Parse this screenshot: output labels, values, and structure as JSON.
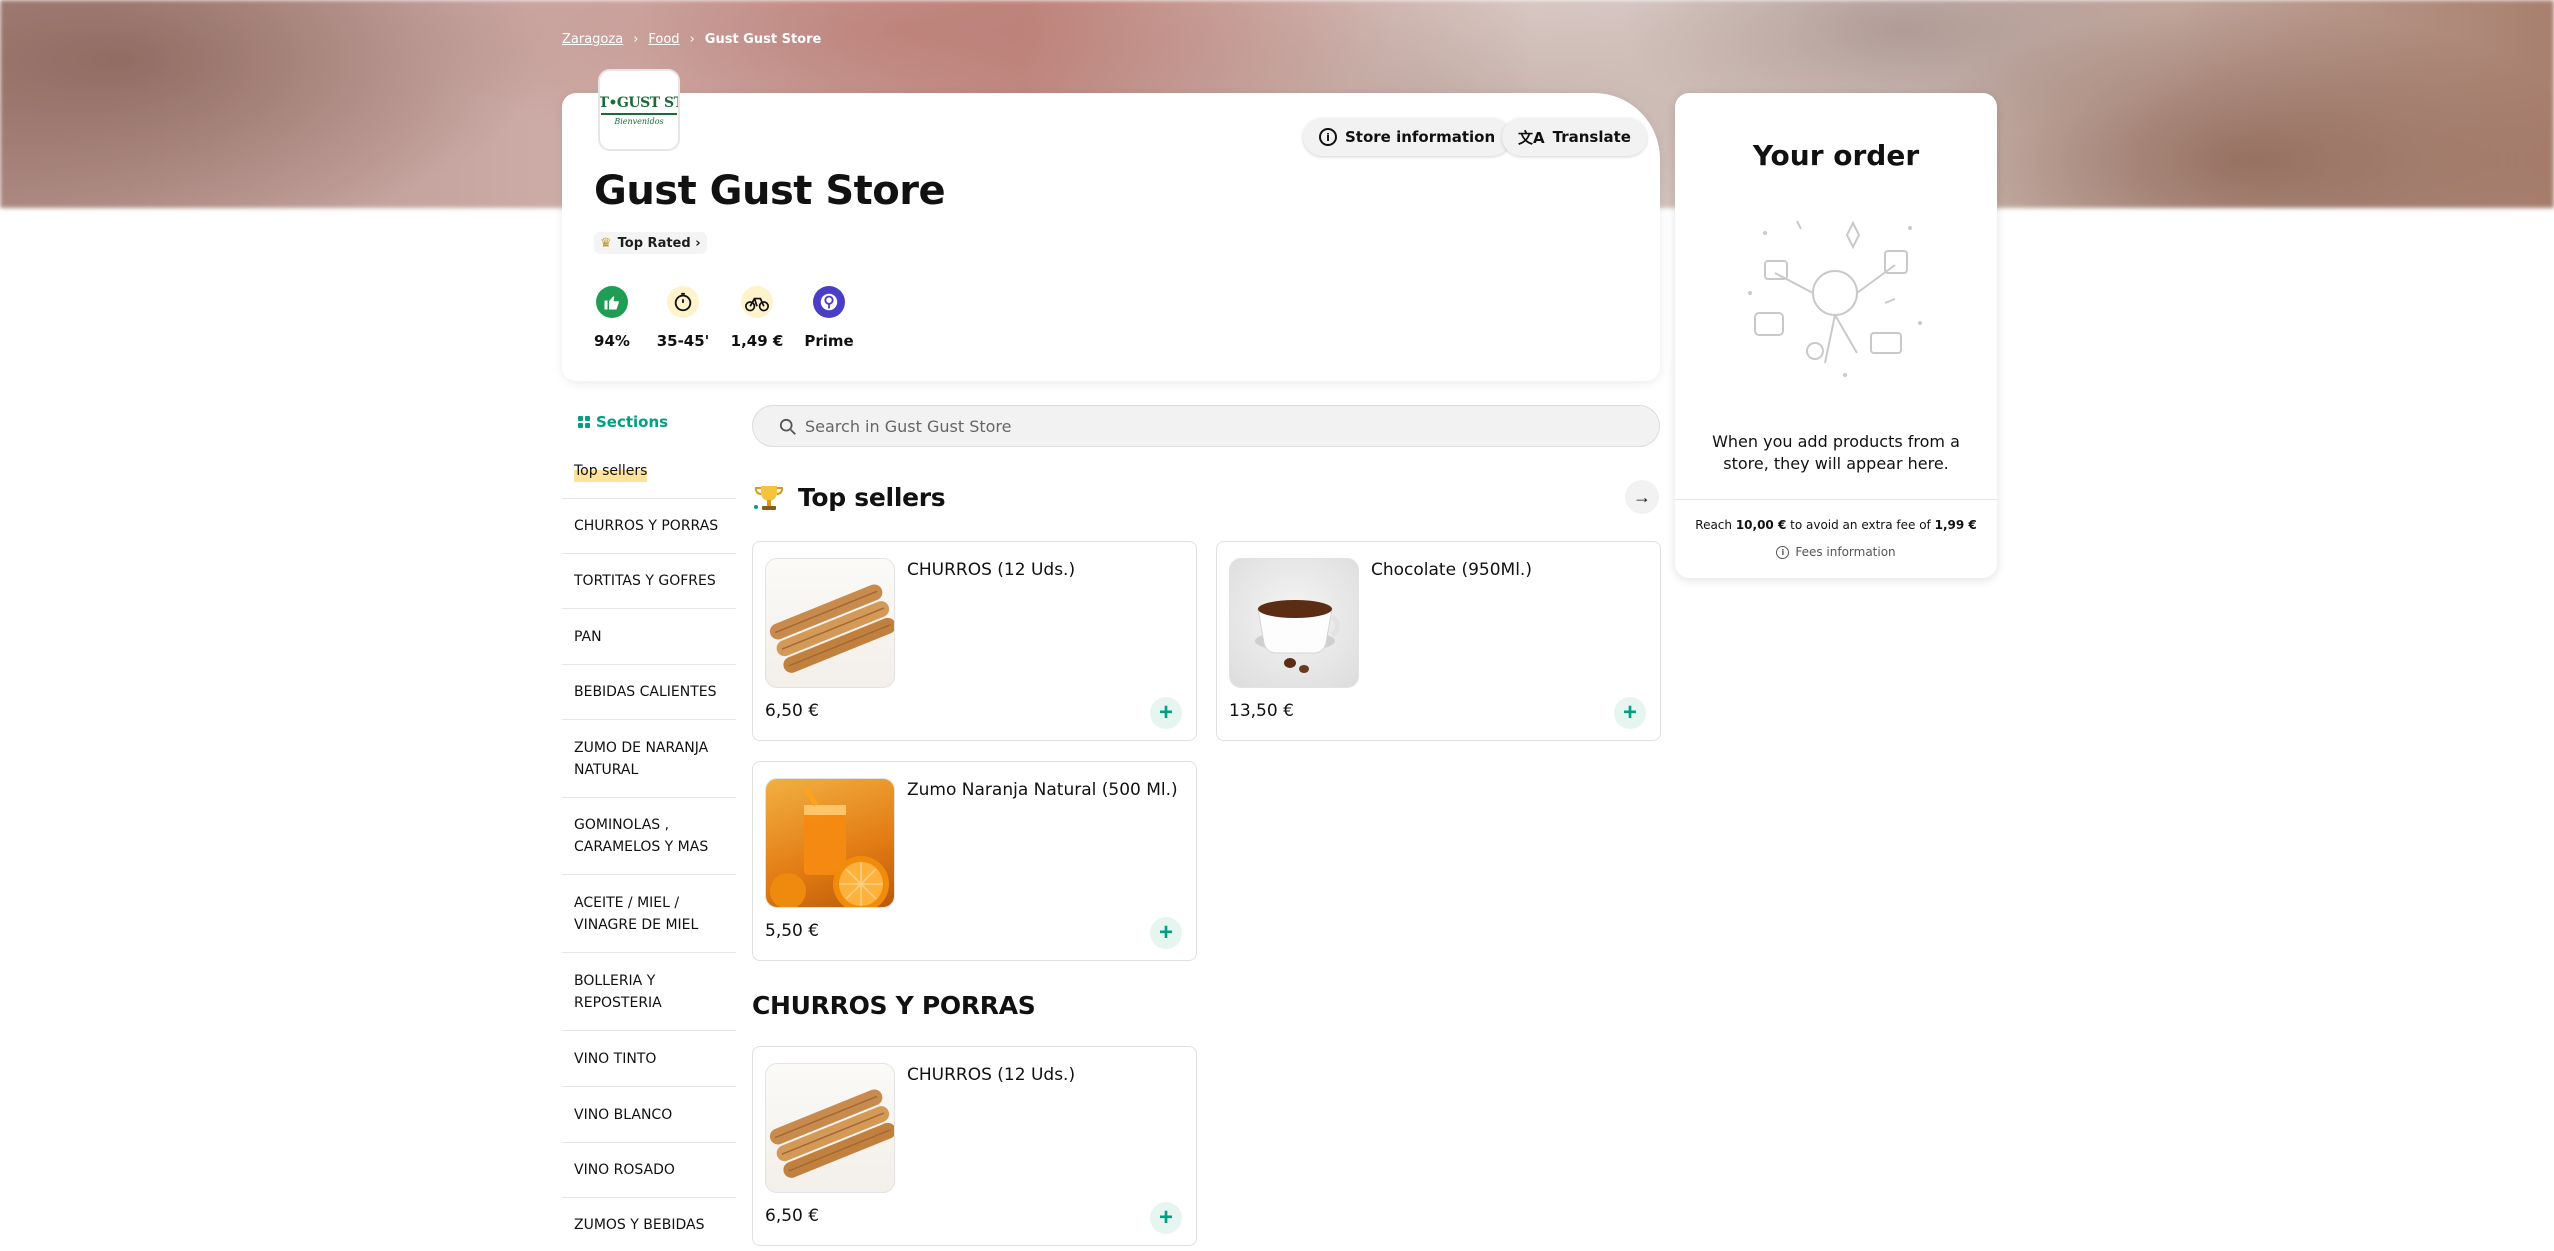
{
  "breadcrumb": {
    "city": "Zaragoza",
    "category": "Food",
    "current": "Gust Gust Store"
  },
  "store": {
    "name": "Gust Gust Store",
    "logo_text": "JST•GUST STO",
    "logo_sub": "Bienvenidos",
    "badge": "Top Rated ›",
    "info_button": "Store information",
    "translate_button": "Translate",
    "stats": [
      {
        "icon": "thumbs-up-icon",
        "label": "94%",
        "color": "#1f9d55"
      },
      {
        "icon": "timer-icon",
        "label": "35-45'",
        "color": "#fff3cc"
      },
      {
        "icon": "bike-icon",
        "label": "1,49 €",
        "color": "#fff3cc"
      },
      {
        "icon": "prime-icon",
        "label": "Prime",
        "color": "#4a3ec7"
      }
    ]
  },
  "order": {
    "title": "Your order",
    "empty_text": "When you add products from a store, they will appear here.",
    "fee_prefix": "Reach ",
    "fee_threshold": "10,00 €",
    "fee_middle": " to avoid an extra fee of ",
    "fee_amount": "1,99 €",
    "fees_info": "Fees information"
  },
  "sidebar": {
    "heading": "Sections",
    "items": [
      "Top sellers",
      "CHURROS Y PORRAS",
      "TORTITAS Y GOFRES",
      "PAN",
      "BEBIDAS CALIENTES",
      "ZUMO DE NARANJA NATURAL",
      "GOMINOLAS , CARAMELOS Y MAS",
      "ACEITE / MIEL / VINAGRE DE MIEL",
      "BOLLERIA Y REPOSTERIA",
      "VINO TINTO",
      "VINO BLANCO",
      "VINO ROSADO",
      "ZUMOS Y BEBIDAS"
    ]
  },
  "search": {
    "placeholder": "Search in Gust Gust Store"
  },
  "sections": {
    "top_sellers_title": "Top sellers",
    "churros_title": "CHURROS Y PORRAS"
  },
  "products": {
    "top1": {
      "name": "CHURROS (12 Uds.)",
      "price": "6,50 €"
    },
    "top2": {
      "name": "Chocolate (950Ml.)",
      "price": "13,50 €"
    },
    "top3": {
      "name": "Zumo Naranja Natural (500 Ml.)",
      "price": "5,50 €"
    },
    "churros1": {
      "name": "CHURROS (12 Uds.)",
      "price": "6,50 €"
    }
  },
  "colors": {
    "accent": "#00a082",
    "highlight": "#ffe39a"
  }
}
